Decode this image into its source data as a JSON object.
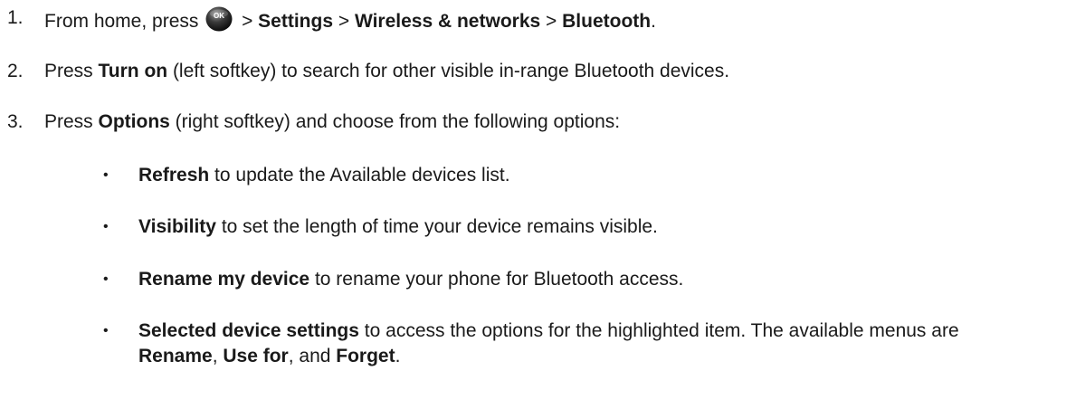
{
  "steps": [
    {
      "number": "1.",
      "prefix": "From home, press",
      "icon_label": "OK",
      "sep1": " > ",
      "bold1": "Settings",
      "sep2": " > ",
      "bold2": "Wireless & networks",
      "sep3": " > ",
      "bold3": "Bluetooth",
      "end": "."
    },
    {
      "number": "2.",
      "prefix": "Press ",
      "bold": "Turn on",
      "suffix": " (left softkey) to search for other visible in-range Bluetooth devices."
    },
    {
      "number": "3.",
      "prefix": "Press ",
      "bold": "Options",
      "suffix": " (right softkey) and choose from the following options:"
    }
  ],
  "options": [
    {
      "marker": "•",
      "bold": "Refresh",
      "text": " to update the Available devices list."
    },
    {
      "marker": "•",
      "bold": "Visibility",
      "text": " to set the length of time your device remains visible."
    },
    {
      "marker": "•",
      "bold": "Rename my device",
      "text": " to rename your phone for Bluetooth access."
    },
    {
      "marker": "•",
      "bold": "Selected device settings",
      "text": " to access the options for the highlighted item. The available menus are ",
      "menu1": "Rename",
      "sep1": ", ",
      "menu2": "Use for",
      "sep2": ", and ",
      "menu3": "Forget",
      "end": "."
    }
  ]
}
